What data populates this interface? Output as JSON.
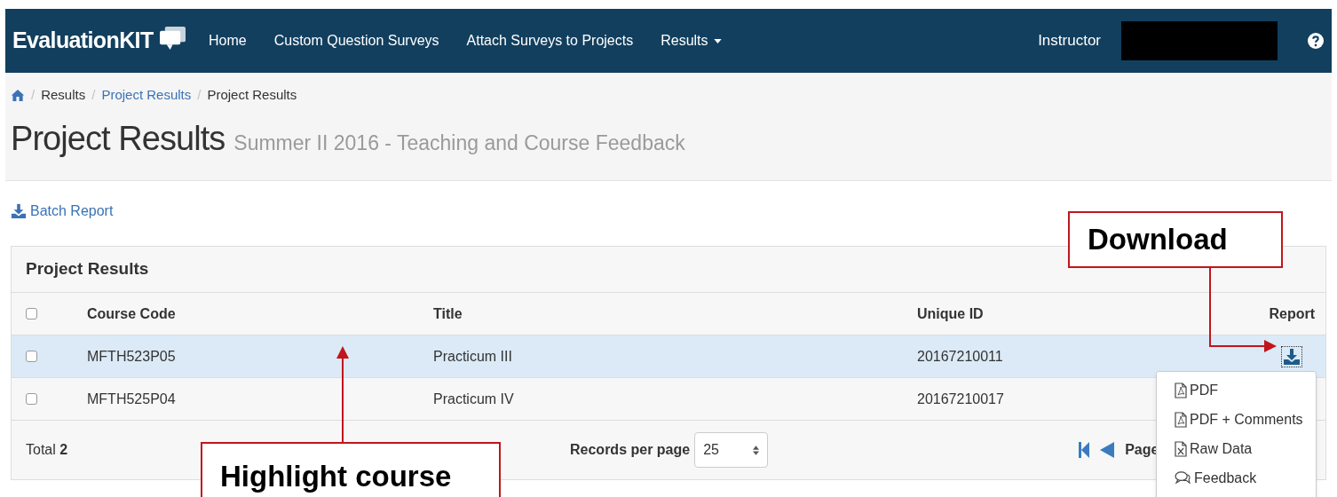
{
  "navbar": {
    "logo": "EvaluationKIT",
    "items": [
      {
        "label": "Home",
        "dropdown": false
      },
      {
        "label": "Custom Question Surveys",
        "dropdown": false
      },
      {
        "label": "Attach Surveys to Projects",
        "dropdown": false
      },
      {
        "label": "Results",
        "dropdown": true
      }
    ],
    "role": "Instructor"
  },
  "breadcrumbs": [
    {
      "separator": "/",
      "label": "Results",
      "link": false
    },
    {
      "separator": "/",
      "label": "Project Results",
      "link": true
    },
    {
      "separator": "/",
      "label": "Project Results",
      "link": false
    }
  ],
  "page_title": "Project Results",
  "page_subtitle": "Summer II 2016 - Teaching and Course Feedback",
  "batch_report": "Batch Report",
  "panel": {
    "title": "Project Results",
    "select_all_checked": false,
    "columns": [
      "Course Code",
      "Title",
      "Unique ID",
      "Report"
    ],
    "rows": [
      {
        "selected": true,
        "checked": false,
        "course_code": "MFTH523P05",
        "title": "Practicum III",
        "unique_id": "20167210011"
      },
      {
        "selected": false,
        "checked": false,
        "course_code": "MFTH525P04",
        "title": "Practicum IV",
        "unique_id": "20167210017"
      }
    ],
    "footer": {
      "total": "Total **2**",
      "records_label": "Records per page",
      "records_value": "25",
      "page_label": "Page"
    }
  },
  "report_menu": [
    {
      "kind": "pdf",
      "label": "PDF"
    },
    {
      "kind": "pdf",
      "label": "PDF + Comments"
    },
    {
      "kind": "excel",
      "label": "Raw Data"
    },
    {
      "kind": "feedback",
      "label": "Feedback"
    }
  ],
  "annotations": [
    {
      "kind": "download",
      "label": "Download"
    },
    {
      "kind": "highlight",
      "label": "Highlight course"
    }
  ]
}
